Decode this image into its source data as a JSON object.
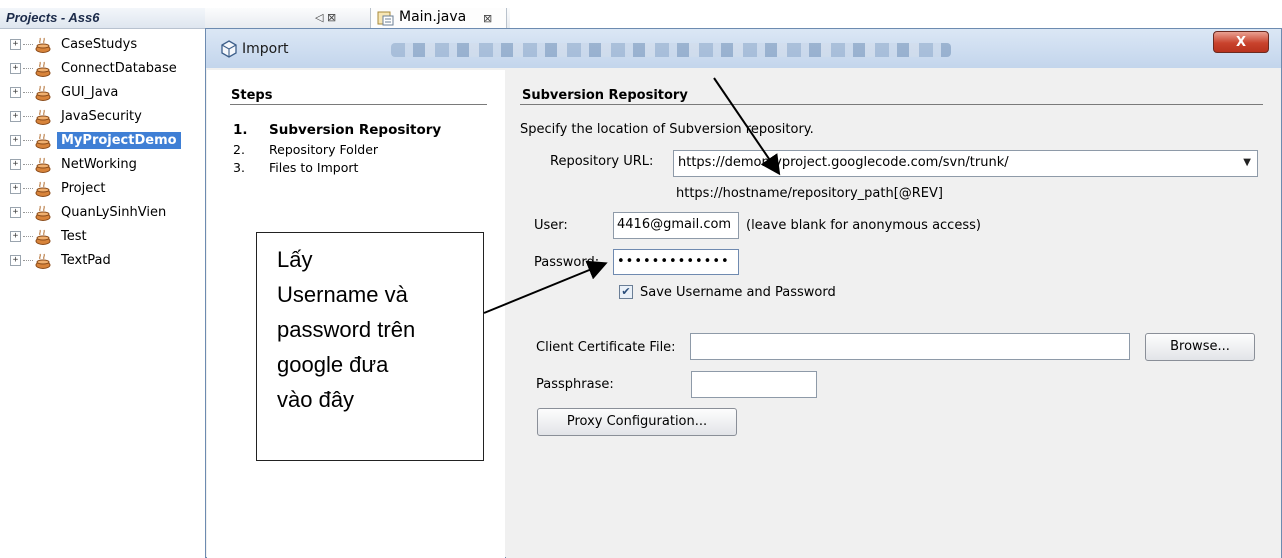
{
  "projects": {
    "title": "Projects - Ass6",
    "items": [
      {
        "label": "CaseStudys",
        "selected": false
      },
      {
        "label": "ConnectDatabase",
        "selected": false
      },
      {
        "label": "GUI_Java",
        "selected": false
      },
      {
        "label": "JavaSecurity",
        "selected": false
      },
      {
        "label": "MyProjectDemo",
        "selected": true
      },
      {
        "label": "NetWorking",
        "selected": false
      },
      {
        "label": "Project",
        "selected": false
      },
      {
        "label": "QuanLySinhVien",
        "selected": false
      },
      {
        "label": "Test",
        "selected": false
      },
      {
        "label": "TextPad",
        "selected": false
      }
    ]
  },
  "editor": {
    "panel_controls": "◁ ⊠",
    "tab_label": "Main.java",
    "tab_close": "⊠"
  },
  "dialog": {
    "title": "Import",
    "close_label": "X",
    "steps": {
      "title": "Steps",
      "items": [
        {
          "num": "1.",
          "label": "Subversion Repository",
          "active": true
        },
        {
          "num": "2.",
          "label": "Repository Folder",
          "active": false
        },
        {
          "num": "3.",
          "label": "Files to Import",
          "active": false
        }
      ]
    },
    "section_title": "Subversion Repository",
    "description": "Specify the location of Subversion repository.",
    "repo_url_label": "Repository URL:",
    "repo_url_value": "https://demomyproject.googlecode.com/svn/trunk/",
    "repo_url_hint": "https://hostname/repository_path[@REV]",
    "user_label": "User:",
    "user_value": "4416@gmail.com",
    "user_hint": "(leave blank for anonymous access)",
    "password_label": "Password:",
    "password_value": "•••••••••••••",
    "save_checkbox_checked": true,
    "save_checkbox_label": "Save Username and Password",
    "cert_label": "Client Certificate File:",
    "cert_value": "",
    "browse_label": "Browse...",
    "passphrase_label": "Passphrase:",
    "passphrase_value": "",
    "proxy_label": "Proxy Configuration..."
  },
  "annotation": {
    "lines": [
      "Lấy",
      "Username và",
      "password trên",
      "google đưa",
      "vào đây"
    ]
  },
  "colors": {
    "selection": "#3f7fd5",
    "dialog_bg": "#f0f0f0",
    "close_button": "#c9432d",
    "titlebar": "#c3d5ec"
  }
}
